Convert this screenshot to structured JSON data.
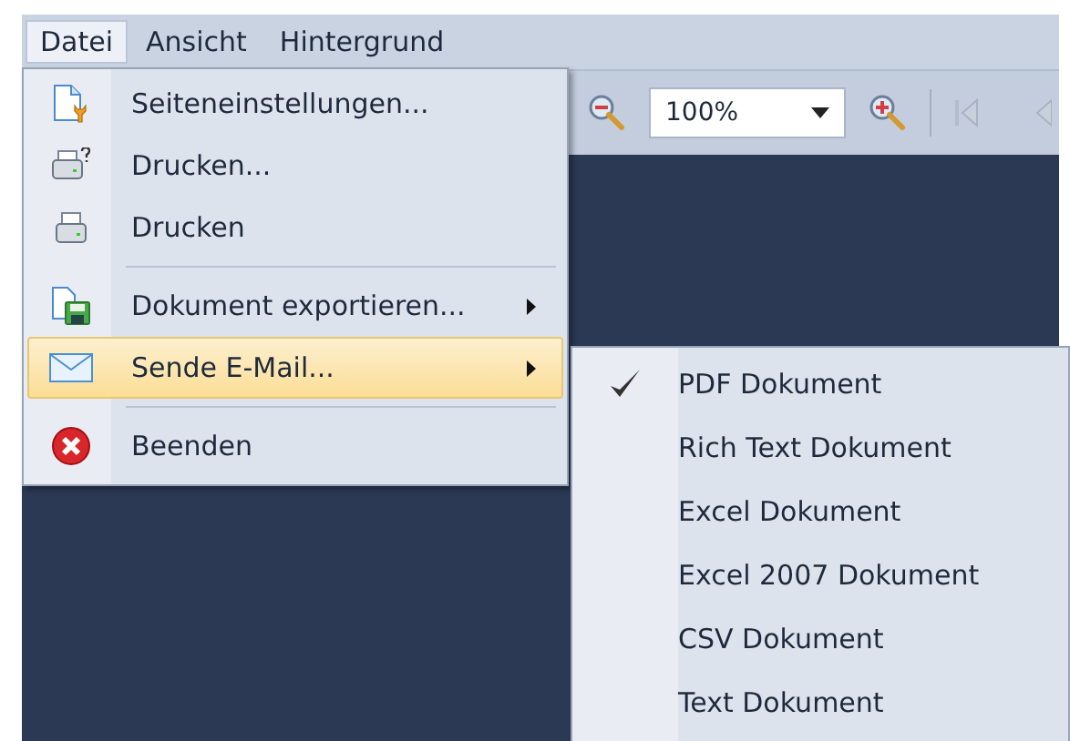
{
  "menubar": [
    {
      "label": "Datei",
      "selected": true
    },
    {
      "label": "Ansicht",
      "selected": false
    },
    {
      "label": "Hintergrund",
      "selected": false
    }
  ],
  "toolbar": {
    "zoom": {
      "value": "100%"
    }
  },
  "menu": {
    "items": [
      {
        "kind": "item",
        "label": "Seiteneinstellungen...",
        "submenu": false,
        "selected": false
      },
      {
        "kind": "item",
        "label": "Drucken...",
        "submenu": false,
        "selected": false
      },
      {
        "kind": "item",
        "label": "Drucken",
        "submenu": false,
        "selected": false
      },
      {
        "kind": "separator"
      },
      {
        "kind": "item",
        "label": "Dokument exportieren...",
        "submenu": true,
        "selected": false
      },
      {
        "kind": "item",
        "label": "Sende E-Mail...",
        "submenu": true,
        "selected": true
      },
      {
        "kind": "separator"
      },
      {
        "kind": "item",
        "label": "Beenden",
        "submenu": false,
        "selected": false
      }
    ]
  },
  "submenu": {
    "items": [
      {
        "label": "PDF Dokument",
        "checked": true
      },
      {
        "label": "Rich Text Dokument",
        "checked": false
      },
      {
        "label": "Excel Dokument",
        "checked": false
      },
      {
        "label": "Excel 2007 Dokument",
        "checked": false
      },
      {
        "label": "CSV Dokument",
        "checked": false
      },
      {
        "label": "Text Dokument",
        "checked": false
      }
    ]
  }
}
